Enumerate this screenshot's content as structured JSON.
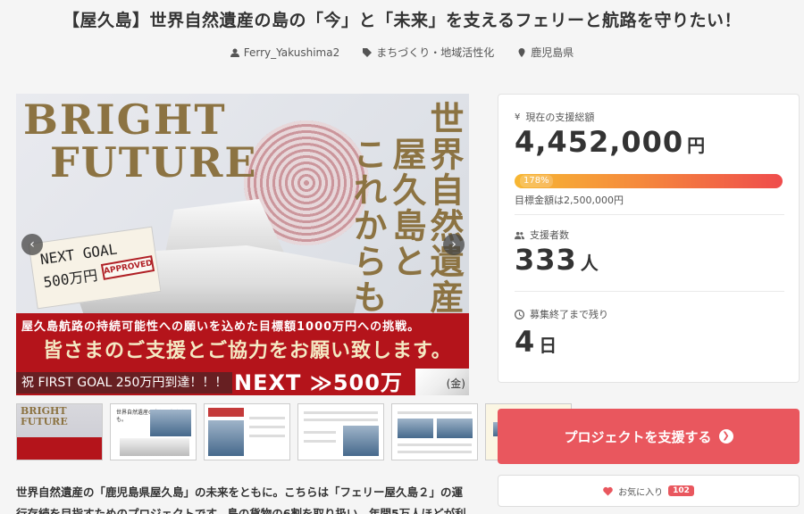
{
  "project": {
    "title": "【屋久島】世界自然遺産の島の「今」と「未来」を支えるフェリーと航路を守りたい！",
    "author": "Ferry_Yakushima2",
    "category": "まちづくり・地域活性化",
    "location": "鹿児島県"
  },
  "hero": {
    "bright": "BRIGHT",
    "future": "FUTURE",
    "vertical_1": "世界自然遺産。",
    "vertical_2": "屋久島と",
    "vertical_3": "これからも。",
    "note_line1": "NEXT GOAL",
    "note_line2": "500万円",
    "stamp": "APPROVED",
    "banner_line1": "屋久島航路の持続可能性への願いを込めた目標額1000万円への挑戦。",
    "banner_line2": "皆さまのご支援とご協力をお願い致します。",
    "celebrate": "祝 FIRST GOAL 250万円到達！！！",
    "next": "NEXT ≫500万",
    "corner": "(金)",
    "prev_arrow": "‹",
    "next_arrow": "›"
  },
  "thumbnails": {
    "t1_title": "BRIGHT FUTURE",
    "t2_text": "世界自然遺産の島とこれからも。"
  },
  "description": "世界自然遺産の「鹿児島県屋久島」の未来をともに。こちらは「フェリー屋久島２」の運行存続を目指すためのプロジェクトです。島の貨物の6割を取り扱い、年間5万人ほどが利",
  "stats": {
    "total_label": "現在の支援総額",
    "total_value": "4,452,000",
    "total_unit": "円",
    "progress_label": "178%",
    "progress_fraction": 1.0,
    "goal_text": "目標金額は2,500,000円",
    "backers_label": "支援者数",
    "backers_value": "333",
    "backers_unit": "人",
    "remaining_label": "募集終了まで残り",
    "remaining_value": "4",
    "remaining_unit": "日"
  },
  "actions": {
    "support_label": "プロジェクトを支援する",
    "favorite_label": "お気に入り",
    "favorite_count": "102"
  },
  "colors": {
    "accent": "#e9575e",
    "banner_red": "#b4141b",
    "gold": "#8c7342"
  }
}
